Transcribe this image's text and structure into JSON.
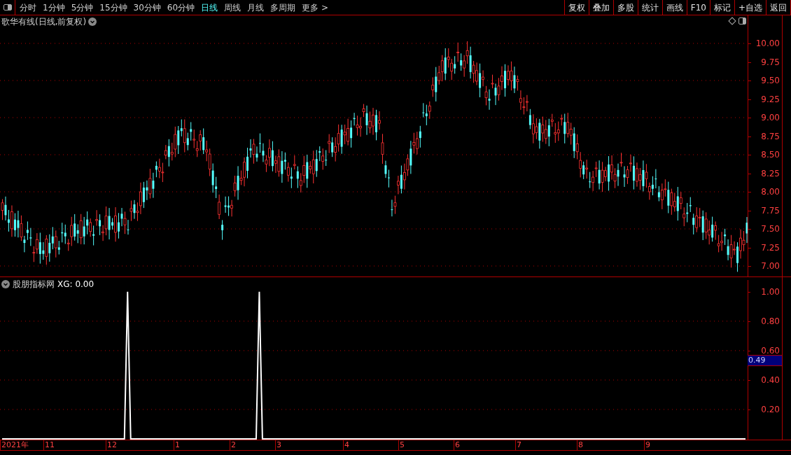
{
  "toolbar": {
    "periods": [
      {
        "label": "分时",
        "selected": false
      },
      {
        "label": "1分钟",
        "selected": false
      },
      {
        "label": "5分钟",
        "selected": false
      },
      {
        "label": "15分钟",
        "selected": false
      },
      {
        "label": "30分钟",
        "selected": false
      },
      {
        "label": "60分钟",
        "selected": false
      },
      {
        "label": "日线",
        "selected": true
      },
      {
        "label": "周线",
        "selected": false
      },
      {
        "label": "月线",
        "selected": false
      },
      {
        "label": "多周期",
        "selected": false
      },
      {
        "label": "更多 >",
        "selected": false
      }
    ],
    "buttons": [
      "复权",
      "叠加",
      "多股",
      "统计",
      "画线",
      "F10",
      "标记",
      "+自选",
      "返回"
    ]
  },
  "price_chart": {
    "title": "歌华有线(日线,前复权)",
    "y_labels": [
      "10.00",
      "9.75",
      "9.50",
      "9.25",
      "9.00",
      "8.75",
      "8.50",
      "8.25",
      "8.00",
      "7.75",
      "7.50",
      "7.25",
      "7.00"
    ]
  },
  "indicator": {
    "title": "股朋指标网",
    "reading": ": 0.00",
    "cursor_value": "0.49",
    "chart_data": {
      "type": "line",
      "categories": [
        null,
        null,
        null,
        null,
        null,
        null,
        null,
        null,
        null,
        null,
        null,
        null,
        null,
        null,
        null,
        null,
        null,
        null,
        null,
        null,
        null,
        null,
        null,
        null,
        null,
        null,
        null,
        null,
        null,
        null,
        null,
        null,
        null,
        null,
        null,
        null,
        null,
        null,
        null,
        null,
        null,
        null,
        null,
        null,
        null,
        null,
        null,
        null,
        null,
        null,
        null,
        null,
        null,
        null,
        null,
        null,
        null,
        null,
        null,
        null,
        null,
        null,
        null,
        null,
        null,
        null,
        null,
        null,
        null,
        null,
        null,
        null,
        null,
        null,
        null,
        null,
        null,
        null,
        null,
        null,
        null,
        null,
        null,
        null,
        null,
        null,
        null,
        null,
        null,
        null,
        null,
        null,
        null,
        null,
        null,
        null,
        null,
        null,
        null,
        null,
        null,
        null,
        null,
        null,
        null,
        null,
        null,
        null,
        null,
        null,
        null,
        null,
        null,
        null,
        null,
        null,
        null,
        null,
        null,
        null,
        null,
        null,
        null,
        null,
        null,
        null,
        null,
        null,
        null,
        null,
        null,
        null,
        null,
        null,
        null,
        null,
        null,
        null,
        null,
        null,
        null,
        null,
        null,
        null,
        null,
        null,
        null,
        null,
        null,
        null,
        null,
        null,
        null,
        null,
        null,
        null,
        null,
        null,
        null,
        null,
        null,
        null,
        null,
        null,
        null,
        null,
        null,
        null,
        null,
        null,
        null,
        null,
        null,
        null,
        null,
        null,
        null,
        null,
        null,
        null,
        null,
        null,
        null,
        null,
        null,
        null,
        null,
        null,
        null,
        null,
        null,
        null,
        null,
        null,
        null,
        null,
        null,
        null,
        null,
        null,
        null,
        null,
        null,
        null,
        null,
        null,
        null,
        null,
        null,
        null,
        null,
        null,
        null,
        null,
        null,
        null,
        null,
        null,
        null,
        null,
        null,
        null,
        null,
        null,
        null,
        null,
        null,
        null,
        null,
        null,
        null,
        null,
        null,
        null,
        null,
        null,
        null,
        null
      ],
      "series": [
        {
          "name": "XG",
          "color": "#ffffff",
          "values": [
            0,
            0,
            0,
            0,
            0,
            0,
            0,
            0,
            0,
            0,
            0,
            0,
            0,
            0,
            0,
            0,
            0,
            0,
            0,
            0,
            0,
            0,
            0,
            0,
            0,
            0,
            0,
            0,
            0,
            0,
            0,
            0,
            0,
            0,
            0,
            0,
            0,
            0,
            0,
            0,
            1,
            0,
            0,
            0,
            0,
            0,
            0,
            0,
            0,
            0,
            0,
            0,
            0,
            0,
            0,
            0,
            0,
            0,
            0,
            0,
            0,
            0,
            0,
            0,
            0,
            0,
            0,
            0,
            0,
            0,
            0,
            0,
            0,
            0,
            0,
            0,
            0,
            0,
            0,
            0,
            0,
            0,
            1,
            0,
            0,
            0,
            0,
            0,
            0,
            0,
            0,
            0,
            0,
            0,
            0,
            0,
            0,
            0,
            0,
            0,
            0,
            0,
            0,
            0,
            0,
            0,
            0,
            0,
            0,
            0,
            0,
            0,
            0,
            0,
            0,
            0,
            0,
            0,
            0,
            0,
            0,
            0,
            0,
            0,
            0,
            0,
            0,
            0,
            0,
            0,
            0,
            0,
            0,
            0,
            0,
            0,
            0,
            0,
            0,
            0,
            0,
            0,
            0,
            0,
            0,
            0,
            0,
            0,
            0,
            0,
            0,
            0,
            0,
            0,
            0,
            0,
            0,
            0,
            0,
            0,
            0,
            0,
            0,
            0,
            0,
            0,
            0,
            0,
            0,
            0,
            0,
            0,
            0,
            0,
            0,
            0,
            0,
            0,
            0,
            0,
            0,
            0,
            0,
            0,
            0,
            0,
            0,
            0,
            0,
            0,
            0,
            0,
            0,
            0,
            0,
            0,
            0,
            0,
            0,
            0,
            0,
            0,
            0,
            0,
            0,
            0,
            0,
            0,
            0,
            0,
            0,
            0,
            0,
            0,
            0,
            0,
            0,
            0,
            0,
            0,
            0,
            0,
            0,
            0,
            0,
            0,
            0,
            0,
            0,
            0,
            0,
            0,
            0,
            0,
            0,
            0,
            0,
            0
          ]
        }
      ],
      "ylim": [
        0,
        1.08
      ],
      "grid": true,
      "yticks": [
        {
          "value": 0.2,
          "label": "0.20"
        },
        {
          "value": 0.4,
          "label": "0.40"
        },
        {
          "value": 0.6,
          "label": "0.60"
        },
        {
          "value": 0.8,
          "label": "0.80"
        },
        {
          "value": 1,
          "label": "1.00"
        }
      ]
    }
  },
  "date_axis": [
    "2021年",
    "11",
    "12",
    "1",
    "2",
    "3",
    "4",
    "5",
    "6",
    "7",
    "8",
    "9"
  ]
}
